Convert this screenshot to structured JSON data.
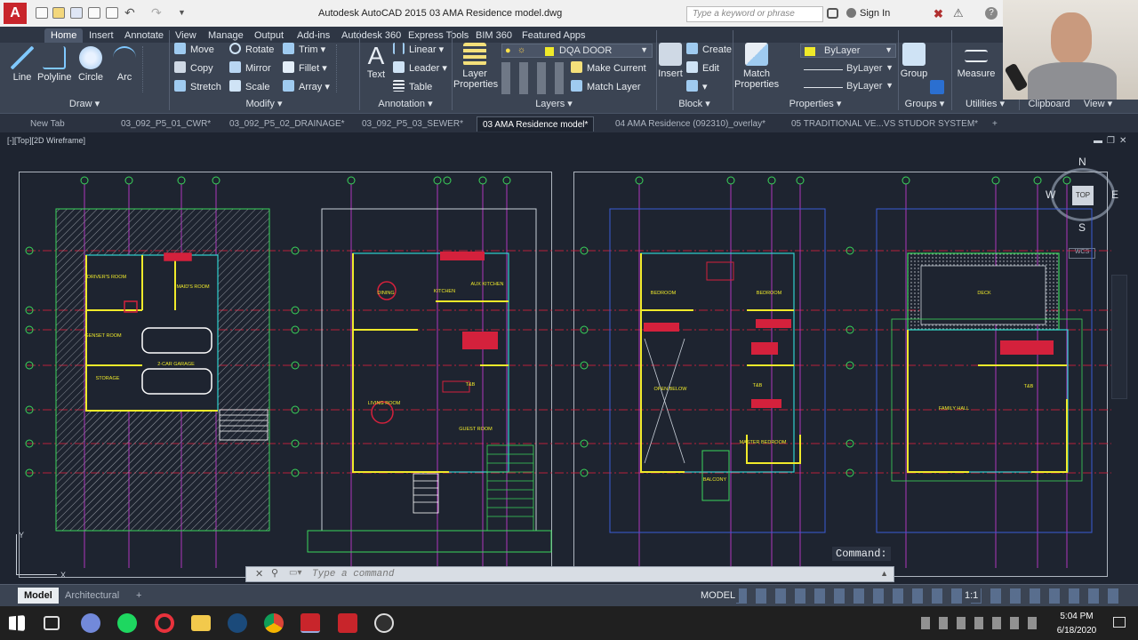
{
  "title_bar": {
    "app_title": "Autodesk AutoCAD 2015",
    "file_name": "03 AMA Residence model.dwg",
    "search_placeholder": "Type a keyword or phrase",
    "sign_in": "Sign In"
  },
  "ribbon": {
    "tabs": [
      "Home",
      "Insert",
      "Annotate",
      "View",
      "Manage",
      "Output",
      "Add-ins",
      "Autodesk 360",
      "Express Tools",
      "BIM 360",
      "Featured Apps"
    ],
    "active_tab": "Home",
    "draw": {
      "line": "Line",
      "polyline": "Polyline",
      "circle": "Circle",
      "arc": "Arc",
      "panel_label": "Draw"
    },
    "modify": {
      "move": "Move",
      "rotate": "Rotate",
      "trim": "Trim",
      "copy": "Copy",
      "mirror": "Mirror",
      "fillet": "Fillet",
      "stretch": "Stretch",
      "scale": "Scale",
      "array": "Array",
      "panel_label": "Modify"
    },
    "annotation": {
      "text": "Text",
      "linear": "Linear",
      "leader": "Leader",
      "table": "Table",
      "panel_label": "Annotation"
    },
    "layers": {
      "layer_properties": "Layer Properties",
      "current_layer": "DQA DOOR",
      "make_current": "Make Current",
      "match_layer": "Match Layer",
      "panel_label": "Layers"
    },
    "block": {
      "insert": "Insert",
      "create": "Create",
      "edit": "Edit",
      "panel_label": "Block"
    },
    "properties": {
      "match_properties": "Match Properties",
      "color": "ByLayer",
      "linetype": "ByLayer",
      "lineweight": "ByLayer",
      "panel_label": "Properties"
    },
    "groups": {
      "group": "Group",
      "panel_label": "Groups"
    },
    "utilities": {
      "measure": "Measure",
      "panel_label": "Utilities"
    },
    "clipboard": {
      "panel_label": "Clipboard"
    },
    "view": {
      "panel_label": "View"
    }
  },
  "file_tabs": [
    "New Tab",
    "03_092_P5_01_CWR*",
    "03_092_P5_02_DRAINAGE*",
    "03_092_P5_03_SEWER*",
    "03 AMA Residence model*",
    "04 AMA Residence (092310)_overlay*",
    "05 TRADITIONAL VE...VS STUDOR SYSTEM*"
  ],
  "active_file_tab": "03 AMA Residence model*",
  "viewport": {
    "label": "[-][Top][2D Wireframe]",
    "viewcube": {
      "n": "N",
      "s": "S",
      "e": "E",
      "w": "W",
      "top": "TOP",
      "wcs": "WCS"
    },
    "axis_x": "X",
    "axis_y": "Y",
    "command_label": "Command:",
    "command_placeholder": "Type a command",
    "room_labels": {
      "drivers_room": "DRIVER'S ROOM",
      "maids_room": "MAID'S ROOM",
      "genset_room": "GENSET ROOM",
      "storage": "STORAGE",
      "garage": "2-CAR GARAGE",
      "dining": "DINING",
      "kitchen": "KITCHEN",
      "aux_kitchen": "AUX KITCHEN",
      "living": "LIVING ROOM",
      "guest": "GUEST ROOM",
      "tb": "T&B",
      "bedroom": "BEDROOM",
      "open_below": "OPEN BELOW",
      "master": "MASTER BEDROOM",
      "balcony": "BALCONY",
      "deck": "DECK",
      "family_hall": "FAMILY HALL"
    }
  },
  "layout_tabs": [
    "Model",
    "Architectural"
  ],
  "active_layout": "Model",
  "status_bar": {
    "model": "MODEL",
    "scale": "1:1"
  },
  "taskbar": {
    "time": "5:04 PM",
    "date": "6/18/2020"
  },
  "colors": {
    "accent_red": "#cc2b2b",
    "grid_red": "#d4213c",
    "wall_cyan": "#2fd3d0",
    "wall_yellow": "#f0ea2a",
    "wall_green": "#3bd65b",
    "magenta": "#c63ad6",
    "drawing_bg": "#1e2430"
  }
}
